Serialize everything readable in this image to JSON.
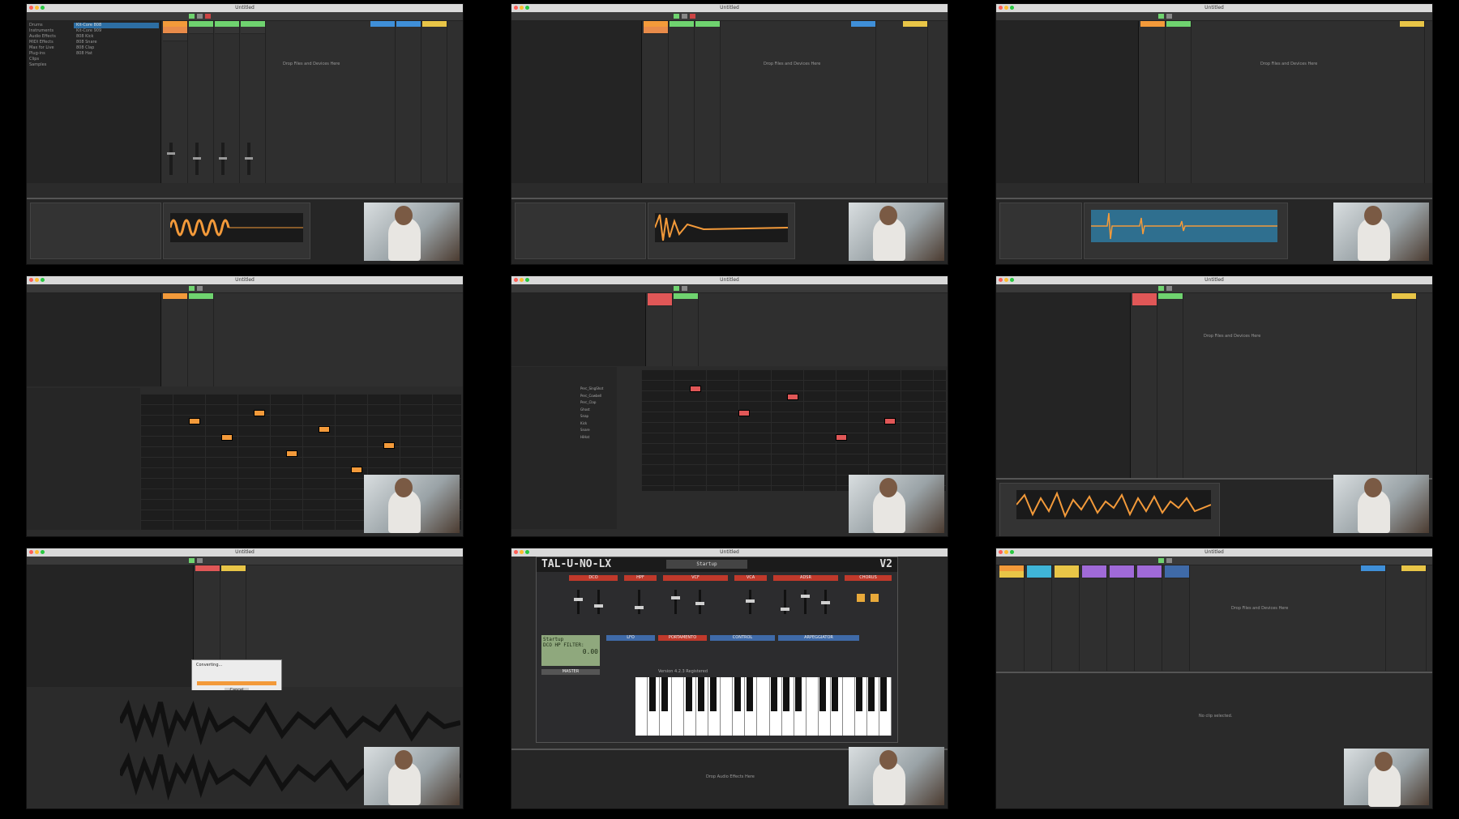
{
  "window": {
    "title": "Untitled"
  },
  "colors": {
    "orange": "#f39a3a",
    "green": "#6fd36f",
    "blue": "#2d6ea3",
    "red": "#e05757",
    "yellow": "#e8c547",
    "synth_blue": "#3f6aa8"
  },
  "panel1": {
    "browser_items": [
      "Drums",
      "Instruments",
      "Audio Effects",
      "MIDI Effects",
      "Max for Live",
      "Plug-ins",
      "Clips",
      "Samples"
    ],
    "file_items": [
      "Kit-Core 808",
      "Kit-Core 909",
      "808 Kick",
      "808 Snare",
      "808 Clap",
      "808 Hat"
    ],
    "drop_text": "Drop Files and Devices Here"
  },
  "panel2": {
    "drop_text": "Drop Files and Devices Here"
  },
  "panel3": {
    "drop_text": "Drop Files and Devices Here"
  },
  "panel5": {
    "lanes": [
      "Perc_SingShot",
      "Perc_Cowbell",
      "Perc_Clap",
      "Ghost",
      "Snap",
      "Kick",
      "Snare",
      "HiHat"
    ]
  },
  "panel6": {
    "drop_text": "Drop Files and Devices Here"
  },
  "panel7": {
    "dialog_title": "Converting...",
    "cancel": "Cancel"
  },
  "synth": {
    "name": "TAL-U-NO-LX",
    "version": "V2",
    "preset": "Startup",
    "lcd_title": "Startup",
    "lcd_param": "DCO HP FILTER:",
    "lcd_value": "0.00",
    "sections": [
      "DCO",
      "HPF",
      "VCF",
      "VCA",
      "ADSR",
      "CHORUS",
      "LFO",
      "PORTAMENTO",
      "CONTROL",
      "ARPEGGIATOR",
      "MASTER"
    ],
    "version_text": "Version 4.2.3 Registered",
    "drop_text": "Drop Audio Effects Here"
  },
  "panel9": {
    "drop_text": "Drop Files and Devices Here",
    "no_clip": "No clip selected."
  }
}
